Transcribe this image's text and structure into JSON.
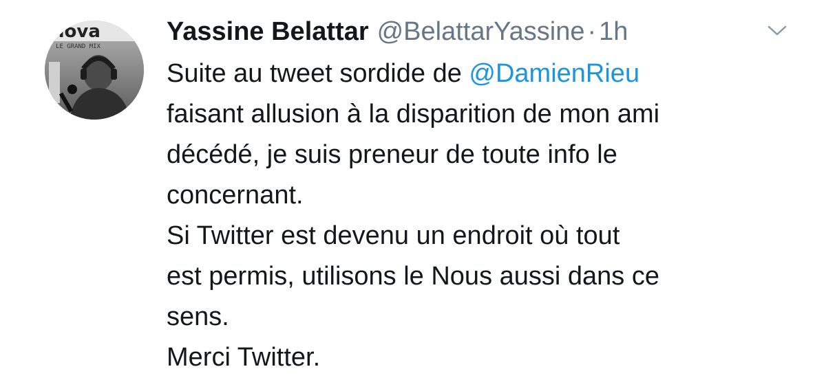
{
  "tweet": {
    "author": {
      "display_name": "Yassine Belattar",
      "handle": "@BelattarYassine",
      "avatar_icon": "profile-photo",
      "avatar_caption_top": "nova",
      "avatar_caption_bottom": "LE GRAND MIX"
    },
    "separator": "·",
    "time": "1h",
    "menu_icon": "chevron-down-icon",
    "text": {
      "line1_before": "Suite au tweet sordide de ",
      "mention": "@DamienRieu",
      "line2": "faisant allusion à la disparition de mon ami",
      "line3": "décédé, je suis preneur de toute info le",
      "line4": "concernant.",
      "line5": "Si Twitter est devenu un endroit où tout",
      "line6": "est permis, utilisons le Nous aussi dans ce",
      "line7": "sens.",
      "line8": "Merci Twitter."
    },
    "colors": {
      "text": "#14171a",
      "secondary": "#657786",
      "link": "#1b95e0"
    }
  }
}
